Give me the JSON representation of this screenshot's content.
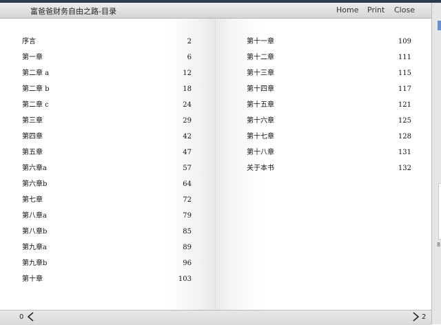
{
  "header": {
    "title": "富爸爸财务自由之路-目录",
    "nav": {
      "home": "Home",
      "print": "Print",
      "close": "Close"
    }
  },
  "toc_left": [
    {
      "chapter": "序言",
      "page": "2"
    },
    {
      "chapter": "第一章",
      "page": "6"
    },
    {
      "chapter": "第二章 a",
      "page": "12"
    },
    {
      "chapter": "第二章 b",
      "page": "18"
    },
    {
      "chapter": "第二章 c",
      "page": "24"
    },
    {
      "chapter": "第三章",
      "page": "29"
    },
    {
      "chapter": "第四章",
      "page": "42"
    },
    {
      "chapter": "第五章",
      "page": "47"
    },
    {
      "chapter": "第六章a",
      "page": "57"
    },
    {
      "chapter": "第六章b",
      "page": "64"
    },
    {
      "chapter": "第七章",
      "page": "72"
    },
    {
      "chapter": "第八章a",
      "page": "79"
    },
    {
      "chapter": "第八章b",
      "page": "85"
    },
    {
      "chapter": "第九章a",
      "page": "89"
    },
    {
      "chapter": "第九章b",
      "page": "96"
    },
    {
      "chapter": "第十章",
      "page": "103"
    }
  ],
  "toc_right": [
    {
      "chapter": "第十一章",
      "page": "109"
    },
    {
      "chapter": "第十二章",
      "page": "111"
    },
    {
      "chapter": "第十三章",
      "page": "115"
    },
    {
      "chapter": "第十四章",
      "page": "117"
    },
    {
      "chapter": "第十五章",
      "page": "121"
    },
    {
      "chapter": "第十六章",
      "page": "125"
    },
    {
      "chapter": "第十七章",
      "page": "128"
    },
    {
      "chapter": "第十八章",
      "page": "131"
    },
    {
      "chapter": "关于本书",
      "page": "132"
    }
  ],
  "footer": {
    "left_page": "0",
    "right_page": "2",
    "prev_icon": "chevron-left-icon",
    "next_icon": "chevron-right-icon"
  },
  "edge": {
    "text": "8"
  },
  "colors": {
    "top_strip": "#2e3a4f",
    "toolbar": "#e0e0e0",
    "edge_accent": "#6b8fc9"
  }
}
